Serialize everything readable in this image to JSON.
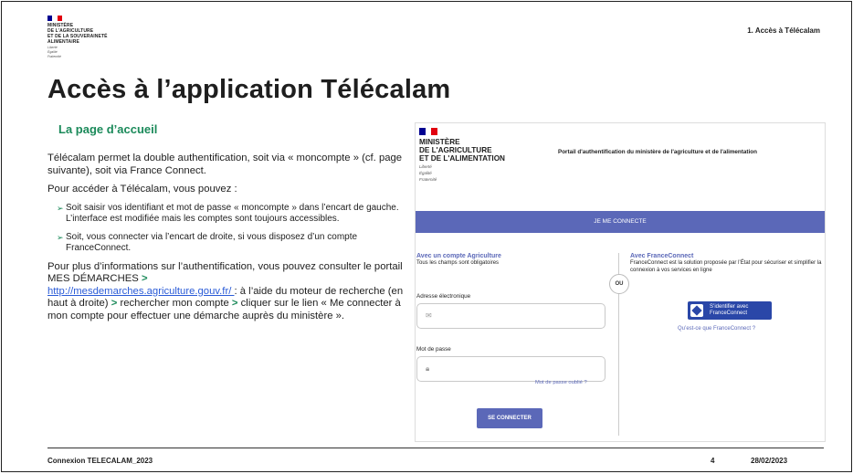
{
  "header": {
    "ministry_lines": [
      "MINISTÈRE",
      "DE L'AGRICULTURE",
      "ET DE LA SOUVERAINETÉ",
      "ALIMENTAIRE"
    ],
    "motto_lines": [
      "Liberté",
      "Égalité",
      "Fraternité"
    ],
    "section_label": "1. Accès à Télécalam"
  },
  "title": "Accès à l’application Télécalam",
  "subtitle": "La page d’accueil",
  "body": {
    "p1": "Télécalam permet la double authentification, soit via « moncompte » (cf. page suivante), soit via France Connect.",
    "p2": "Pour accéder à Télécalam, vous pouvez :",
    "bullets": [
      "Soit saisir vos identifiant et mot de passe « moncompte » dans l’encart de gauche. L’interface est modifiée mais les comptes sont toujours accessibles.",
      "Soit, vous connecter via l’encart de droite, si vous disposez d’un compte FranceConnect."
    ],
    "p3_a": "Pour plus d’informations sur l’authentification, vous pouvez consulter le portail MES DÉMARCHES ",
    "p3_link": "http://mesdemarches.agriculture.gouv.fr/ ",
    "p3_b": ": à l’aide du moteur de recherche (en haut à droite) ",
    "p3_c": " rechercher mon compte ",
    "p3_d": " cliquer sur le lien « Me connecter à mon compte pour effectuer une démarche auprès du ministère ».",
    "arrow": ">"
  },
  "screenshot": {
    "ministry_lines": [
      "MINISTÈRE",
      "DE L'AGRICULTURE",
      "ET DE L'ALIMENTATION"
    ],
    "motto_lines": [
      "Liberté",
      "Égalité",
      "Fraternité"
    ],
    "portal_title": "Portail d'authentification du ministère de l'agriculture et de l'alimentation",
    "connect_bar": "JE ME CONNECTE",
    "left_title": "Avec un compte Agriculture",
    "left_sub": "Tous les champs sont obligatoires",
    "email_label": "Adresse électronique",
    "password_label": "Mot de passe",
    "forgot_link": "Mot de passe oublié ?",
    "login_button": "SE CONNECTER",
    "or_label": "OU",
    "right_title": "Avec FranceConnect",
    "right_desc": "FranceConnect est la solution proposée par l’État pour sécuriser et simplifier la connexion à vos services en ligne",
    "fc_button_line1": "S’identifier avec",
    "fc_button_line2": "FranceConnect",
    "fc_link": "Qu’est-ce que FranceConnect ?"
  },
  "footer": {
    "left": "Connexion TELECALAM_2023",
    "page": "4",
    "date": "28/02/2023"
  },
  "colors": {
    "flag_blue": "#000091",
    "flag_red": "#e1000f",
    "accent_green": "#1b8a5a",
    "portal_blue": "#5b68b8"
  },
  "icons": {
    "email": "envelope-icon",
    "password": "lock-icon",
    "franceconnect": "franceconnect-logo-icon"
  }
}
